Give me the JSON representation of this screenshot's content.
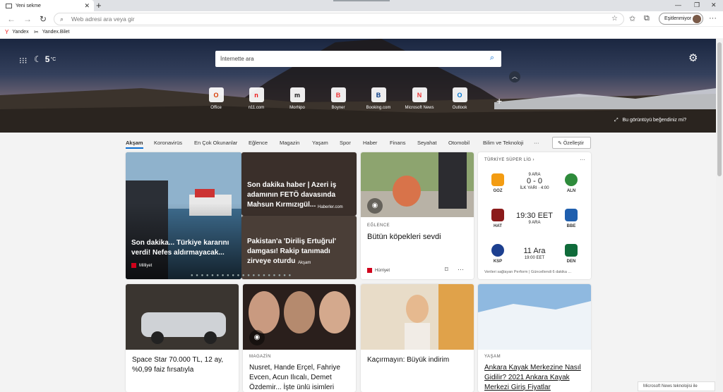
{
  "browser": {
    "tab_title": "Yeni sekme",
    "new_tab_symbol": "+",
    "address_placeholder": "Web adresi ara veya gir",
    "sync_label": "Eşitlenmiyor",
    "bookmarks": [
      "Yandex",
      "Yandex.Bilet"
    ]
  },
  "hero": {
    "weather_temp": "5",
    "weather_unit": "°C",
    "search_placeholder": "İnternette ara",
    "feedback": "Bu görüntüyü beğendiniz mi?",
    "quick_links": [
      {
        "label": "Office",
        "glyph": "O",
        "color": "#d83b01"
      },
      {
        "label": "n11.com",
        "glyph": "n",
        "color": "#e11"
      },
      {
        "label": "Morhipo",
        "glyph": "m",
        "color": "#111"
      },
      {
        "label": "Boyner",
        "glyph": "B",
        "color": "#e33"
      },
      {
        "label": "Booking.com",
        "glyph": "B",
        "color": "#003580"
      },
      {
        "label": "Microsoft News",
        "glyph": "N",
        "color": "#e33"
      },
      {
        "label": "Outlook",
        "glyph": "O",
        "color": "#0078d4"
      }
    ]
  },
  "categories": [
    "Akşam",
    "Koronavirüs",
    "En Çok Okunanlar",
    "Eğlence",
    "Magazin",
    "Yaşam",
    "Spor",
    "Haber",
    "Finans",
    "Seyahat",
    "Otomobil",
    "Bilim ve Teknoloji",
    "···"
  ],
  "personalize": "Özelleştir",
  "hero_card": {
    "title": "Son dakika... Türkiye kararını verdi! Nefes aldırmayacak...",
    "source": "Milliyet"
  },
  "side_cards": [
    {
      "title": "Son dakika haber | Azeri iş adamının FETÖ davasında Mahsun Kırmızıgül...",
      "source": "Haberler.com"
    },
    {
      "title": "Pakistan'a 'Diriliş Ertuğrul' damgası! Rakip tanımadı zirveye oturdu",
      "source": "Akşam"
    }
  ],
  "dog_card": {
    "label": "EĞLENCE",
    "title": "Bütün köpekleri sevdi",
    "source": "Hürriyet"
  },
  "sports": {
    "header": "TÜRKİYE SÜPER LİG",
    "matches": [
      {
        "home": "GOZ",
        "away": "ALN",
        "date": "9 ARA",
        "score": "0 - 0",
        "status": "İLK YARI · 4:00",
        "home_color": "#f39c12",
        "away_color": "#2e8b3b"
      },
      {
        "home": "HAT",
        "away": "BBE",
        "date": "9 ARA",
        "score": "19:30 EET",
        "status": "",
        "home_color": "#8b1a1a",
        "away_color": "#1f5fae"
      },
      {
        "home": "KSP",
        "away": "DEN",
        "date": "",
        "score": "11 Ara",
        "status": "19:00 EET",
        "home_color": "#1c3f8f",
        "away_color": "#0f6b3a"
      }
    ],
    "footer": "Verileri sağlayan Perform | Güncellendi 6 dakika ..."
  },
  "bottom_cards": [
    {
      "label": "",
      "title": "Space Star 70.000 TL, 12 ay, %0,99 faiz fırsatıyla"
    },
    {
      "label": "MAGAZİN",
      "title": "Nusret, Hande Erçel, Fahriye Evcen, Acun Ilıcalı, Demet Özdemir... İşte ünlü isimleri"
    },
    {
      "label": "",
      "title": "Kaçırmayın: Büyük indirim"
    },
    {
      "label": "YAŞAM",
      "title": "Ankara Kayak Merkezine Nasıl Gidilir? 2021 Ankara Kayak Merkezi Giriş Fiyatlar"
    }
  ],
  "news_badge": "Microsoft News teknolojisi ile"
}
